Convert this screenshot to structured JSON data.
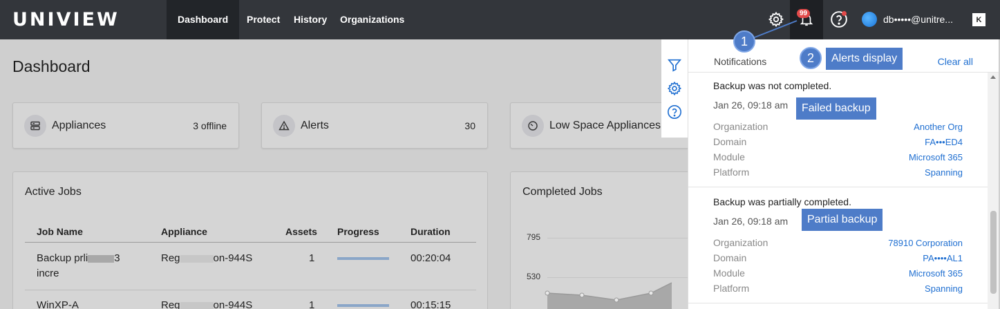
{
  "header": {
    "logo": "UNIVIEW",
    "nav": [
      "Dashboard",
      "Protect",
      "History",
      "Organizations"
    ],
    "active_nav": "Dashboard",
    "notification_count": "99",
    "user": "db•••••@unitre...",
    "brand_mark": "K"
  },
  "page": {
    "title": "Dashboard"
  },
  "cards": [
    {
      "label": "Appliances",
      "value": "3 offline",
      "icon": "server-icon"
    },
    {
      "label": "Alerts",
      "value": "30",
      "icon": "warning-icon"
    },
    {
      "label": "Low Space Appliances",
      "value": "",
      "icon": "gauge-icon"
    }
  ],
  "active_jobs": {
    "title": "Active Jobs",
    "columns": [
      "Job Name",
      "Appliance",
      "Assets",
      "Progress",
      "Duration"
    ],
    "rows": [
      {
        "name_a": "Backup prli",
        "name_b": "3",
        "name_c": "incre",
        "appliance_a": "Reg",
        "appliance_b": "on-944S",
        "assets": "1",
        "progress": 1.0,
        "duration": "00:20:04"
      },
      {
        "name_a": "WinXP-A",
        "name_b": "",
        "name_c": "",
        "appliance_a": "Reg",
        "appliance_b": "on-944S",
        "assets": "1",
        "progress": 1.0,
        "duration": "00:15:15"
      }
    ]
  },
  "completed_jobs": {
    "title": "Completed Jobs",
    "y_ticks": [
      "795",
      "530"
    ]
  },
  "tool_rail": [
    "filter-icon",
    "settings-icon",
    "help-icon"
  ],
  "notifications": {
    "title": "Notifications",
    "clear_all": "Clear all",
    "field_labels": [
      "Organization",
      "Domain",
      "Module",
      "Platform"
    ],
    "items": [
      {
        "message": "Backup was not completed.",
        "time": "Jan 26, 09:18 am",
        "organization": "Another Org",
        "domain": "FA•••ED4",
        "module": "Microsoft 365",
        "platform": "Spanning"
      },
      {
        "message": "Backup was partially completed.",
        "time": "Jan 26, 09:18 am",
        "organization": "78910 Corporation",
        "domain": "PA••••AL1",
        "module": "Microsoft 365",
        "platform": "Spanning"
      }
    ]
  },
  "annotations": {
    "callout_1": "1",
    "callout_2": "2",
    "alerts_display": "Alerts display",
    "failed_backup": "Failed backup",
    "partial_backup": "Partial backup"
  },
  "colors": {
    "topbar": "#33363b",
    "link": "#1f6fd1",
    "badge": "#e24a4a",
    "callout": "#4e7cc8"
  }
}
